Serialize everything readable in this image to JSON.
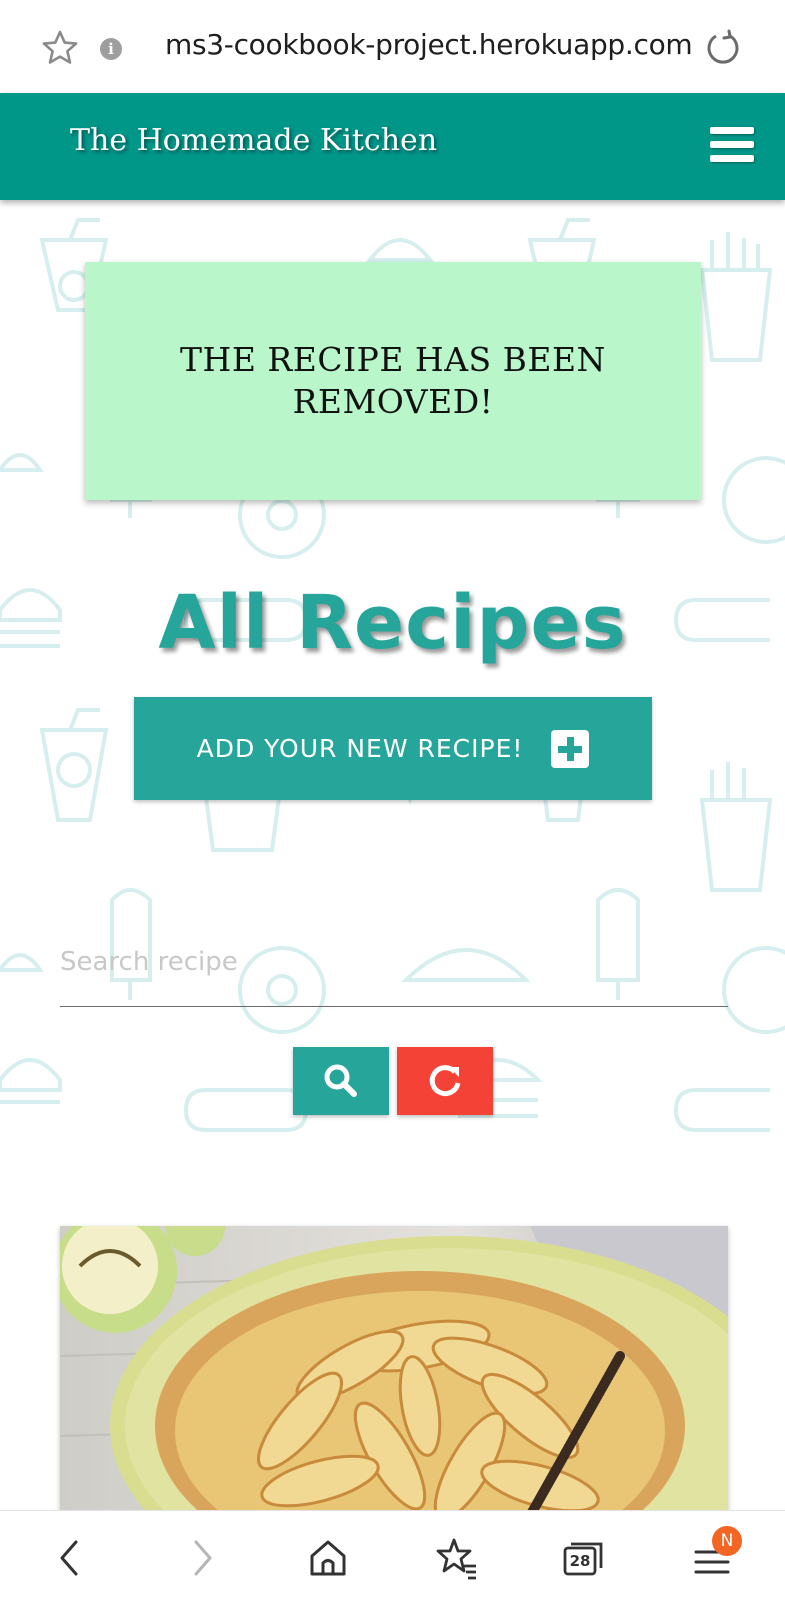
{
  "browser": {
    "url": "ms3-cookbook-project.herokuapp.com",
    "tab_count": "28",
    "menu_badge": "N"
  },
  "navbar": {
    "brand": "The Homemade Kitchen"
  },
  "flash": {
    "message": "THE RECIPE HAS BEEN REMOVED!"
  },
  "page": {
    "title": "All Recipes",
    "add_button_label": "ADD YOUR NEW RECIPE!"
  },
  "search": {
    "placeholder": "Search recipe",
    "value": ""
  },
  "colors": {
    "navbar": "#009688",
    "accent": "#26a69a",
    "flash_bg": "#b9f6ca",
    "reset_button": "#f44336",
    "badge": "#f26522"
  },
  "icons": {
    "favorite": "star-icon",
    "site_info": "info-icon",
    "reload": "reload-icon",
    "menu": "hamburger-icon",
    "add": "plus-square-icon",
    "search": "search-icon",
    "reset": "redo-icon",
    "back": "back-icon",
    "forward": "forward-icon",
    "home": "home-icon",
    "bookmarks": "bookmarks-icon",
    "tabs": "tabs-icon",
    "browser_menu": "browser-menu-icon"
  }
}
